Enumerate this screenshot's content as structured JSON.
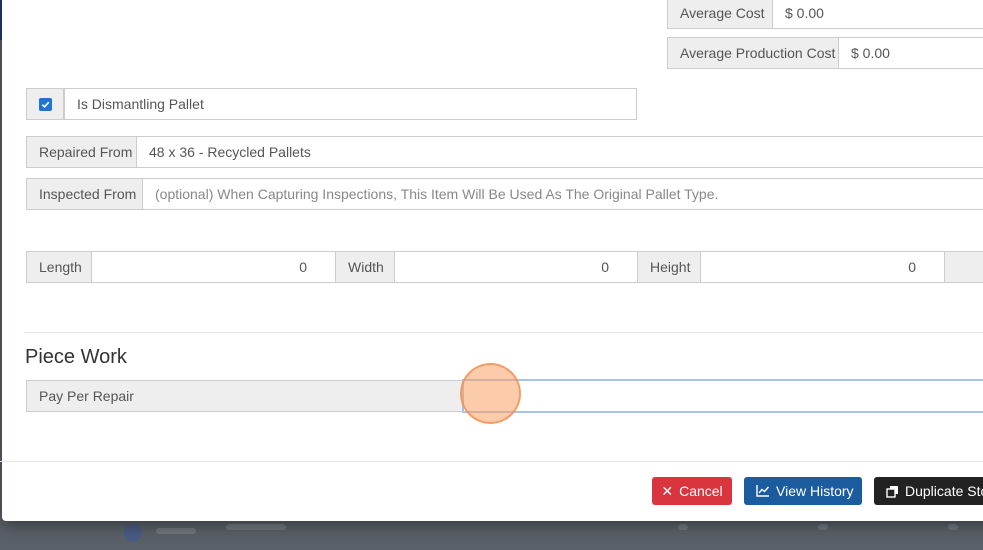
{
  "costs": {
    "average_cost_label": "Average Cost",
    "average_cost_value": "$ 0.00",
    "average_production_cost_label": "Average Production Cost",
    "average_production_cost_value": "$ 0.00"
  },
  "dismantling": {
    "checked": true,
    "label": "Is Dismantling Pallet"
  },
  "repaired_from": {
    "label": "Repaired From",
    "value": "48 x 36 - Recycled Pallets"
  },
  "inspected_from": {
    "label": "Inspected From",
    "placeholder": "(optional) When Capturing Inspections, This Item Will Be Used As The Original Pallet Type."
  },
  "dimensions": {
    "length_label": "Length",
    "length_value": "0",
    "width_label": "Width",
    "width_value": "0",
    "height_label": "Height",
    "height_value": "0"
  },
  "piece_work": {
    "title": "Piece Work",
    "pay_per_repair_label": "Pay Per Repair",
    "pay_per_repair_value": ""
  },
  "footer": {
    "cancel_label": "Cancel",
    "view_history_label": "View History",
    "duplicate_label": "Duplicate Stock"
  },
  "colors": {
    "cancel": "#d9353e",
    "history": "#1b5c9e",
    "duplicate": "#222222",
    "checkbox": "#1e73d9"
  }
}
